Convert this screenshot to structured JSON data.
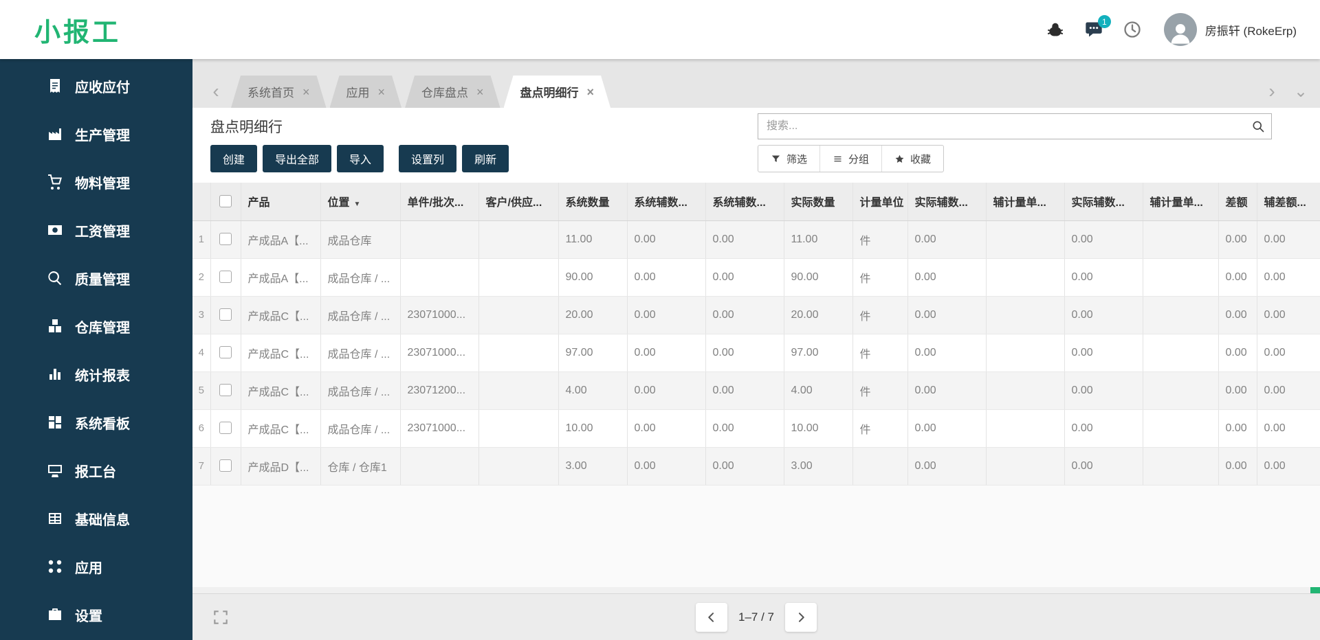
{
  "brand": {
    "logo": "小报工"
  },
  "topbar": {
    "user_name": "房振轩 (RokeErp)",
    "chat_badge": "1"
  },
  "sidebar": {
    "items": [
      {
        "key": "receivables",
        "label": "应收应付",
        "icon": "receipt-icon"
      },
      {
        "key": "production",
        "label": "生产管理",
        "icon": "production-icon"
      },
      {
        "key": "materials",
        "label": "物料管理",
        "icon": "materials-icon"
      },
      {
        "key": "payroll",
        "label": "工资管理",
        "icon": "payroll-icon"
      },
      {
        "key": "quality",
        "label": "质量管理",
        "icon": "quality-icon"
      },
      {
        "key": "warehouse",
        "label": "仓库管理",
        "icon": "warehouse-icon"
      },
      {
        "key": "reports",
        "label": "统计报表",
        "icon": "reports-icon"
      },
      {
        "key": "dashboard",
        "label": "系统看板",
        "icon": "dashboard-icon"
      },
      {
        "key": "workbench",
        "label": "报工台",
        "icon": "workbench-icon"
      },
      {
        "key": "basic-info",
        "label": "基础信息",
        "icon": "basicinfo-icon"
      },
      {
        "key": "apps",
        "label": "应用",
        "icon": "apps-icon"
      },
      {
        "key": "settings",
        "label": "设置",
        "icon": "settings-icon"
      }
    ]
  },
  "tabs": {
    "items": [
      {
        "key": "home",
        "label": "系统首页",
        "active": false
      },
      {
        "key": "apps",
        "label": "应用",
        "active": false
      },
      {
        "key": "inventory-count",
        "label": "仓库盘点",
        "active": false
      },
      {
        "key": "count-lines",
        "label": "盘点明细行",
        "active": true
      }
    ]
  },
  "page": {
    "title": "盘点明细行"
  },
  "search": {
    "placeholder": "搜索..."
  },
  "toolbar": {
    "actions": [
      {
        "key": "create",
        "label": "创建"
      },
      {
        "key": "export-all",
        "label": "导出全部"
      },
      {
        "key": "import",
        "label": "导入"
      },
      {
        "key": "set-columns",
        "label": "设置列"
      },
      {
        "key": "refresh",
        "label": "刷新"
      }
    ],
    "view_controls": [
      {
        "key": "filter",
        "label": "筛选",
        "icon": "funnel-icon"
      },
      {
        "key": "group",
        "label": "分组",
        "icon": "group-icon"
      },
      {
        "key": "favorite",
        "label": "收藏",
        "icon": "star-icon"
      }
    ]
  },
  "table": {
    "columns": [
      {
        "label": "产品"
      },
      {
        "label": "位置",
        "sorted": "desc"
      },
      {
        "label": "单件/批次..."
      },
      {
        "label": "客户/供应..."
      },
      {
        "label": "系统数量"
      },
      {
        "label": "系统辅数..."
      },
      {
        "label": "系统辅数..."
      },
      {
        "label": "实际数量"
      },
      {
        "label": "计量单位"
      },
      {
        "label": "实际辅数..."
      },
      {
        "label": "辅计量单..."
      },
      {
        "label": "实际辅数..."
      },
      {
        "label": "辅计量单..."
      },
      {
        "label": "差额"
      },
      {
        "label": "辅差额..."
      }
    ],
    "rows": [
      {
        "num": "1",
        "cells": [
          "产成品A【...",
          "成品仓库",
          "",
          "",
          "11.00",
          "0.00",
          "0.00",
          "11.00",
          "件",
          "0.00",
          "",
          "0.00",
          "",
          "0.00",
          "0.00"
        ]
      },
      {
        "num": "2",
        "cells": [
          "产成品A【...",
          "成品仓库 / ...",
          "",
          "",
          "90.00",
          "0.00",
          "0.00",
          "90.00",
          "件",
          "0.00",
          "",
          "0.00",
          "",
          "0.00",
          "0.00"
        ]
      },
      {
        "num": "3",
        "cells": [
          "产成品C【...",
          "成品仓库 / ...",
          "23071000...",
          "",
          "20.00",
          "0.00",
          "0.00",
          "20.00",
          "件",
          "0.00",
          "",
          "0.00",
          "",
          "0.00",
          "0.00"
        ]
      },
      {
        "num": "4",
        "cells": [
          "产成品C【...",
          "成品仓库 / ...",
          "23071000...",
          "",
          "97.00",
          "0.00",
          "0.00",
          "97.00",
          "件",
          "0.00",
          "",
          "0.00",
          "",
          "0.00",
          "0.00"
        ]
      },
      {
        "num": "5",
        "cells": [
          "产成品C【...",
          "成品仓库 / ...",
          "23071200...",
          "",
          "4.00",
          "0.00",
          "0.00",
          "4.00",
          "件",
          "0.00",
          "",
          "0.00",
          "",
          "0.00",
          "0.00"
        ]
      },
      {
        "num": "6",
        "cells": [
          "产成品C【...",
          "成品仓库 / ...",
          "23071000...",
          "",
          "10.00",
          "0.00",
          "0.00",
          "10.00",
          "件",
          "0.00",
          "",
          "0.00",
          "",
          "0.00",
          "0.00"
        ]
      },
      {
        "num": "7",
        "cells": [
          "产成品D【...",
          "仓库 / 仓库1",
          "",
          "",
          "3.00",
          "0.00",
          "0.00",
          "3.00",
          "",
          "0.00",
          "",
          "0.00",
          "",
          "0.00",
          "0.00"
        ]
      }
    ]
  },
  "footer": {
    "pagination": "1–7 / 7"
  },
  "colors": {
    "accent_green": "#21b573",
    "sidebar_navy": "#173a50",
    "badge_teal": "#12b0bd"
  }
}
